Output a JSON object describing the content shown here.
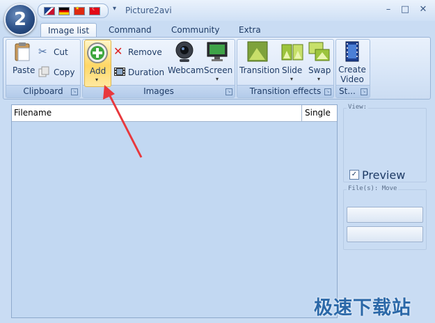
{
  "window": {
    "title": "Picture2avi",
    "minimize": "–",
    "maximize": "□",
    "close": "✕",
    "qat_dropdown": "▾"
  },
  "app_orb": {
    "text": "2"
  },
  "flags": [
    "uk-flag-icon",
    "germany-flag-icon",
    "china-flag-icon",
    "turkey-flag-icon"
  ],
  "tabs": [
    {
      "label": "Image list",
      "active": true
    },
    {
      "label": "Command"
    },
    {
      "label": "Community"
    },
    {
      "label": "Extra"
    }
  ],
  "ribbon": {
    "clipboard": {
      "label": "Clipboard",
      "paste": "Paste",
      "cut": "Cut",
      "copy": "Copy"
    },
    "images": {
      "label": "Images",
      "add": "Add",
      "remove": "Remove",
      "duration": "Duration",
      "webcam": "Webcam",
      "screen": "Screen"
    },
    "transition_effects": {
      "label": "Transition effects",
      "transition": "Transition",
      "slide": "Slide",
      "swap": "Swap"
    },
    "start": {
      "label": "St...",
      "create_video": "Create Video"
    }
  },
  "file_list": {
    "columns": [
      "Filename",
      "Single"
    ]
  },
  "right_panel": {
    "view_legend": "View:",
    "preview_label": "Preview",
    "preview_checked": true,
    "files_legend": "File(s): Move"
  },
  "watermark": "极速下载站",
  "colors": {
    "accent": "#2b68a8",
    "arrow": "#e8383d",
    "ribbon": "#d7e5f7"
  }
}
